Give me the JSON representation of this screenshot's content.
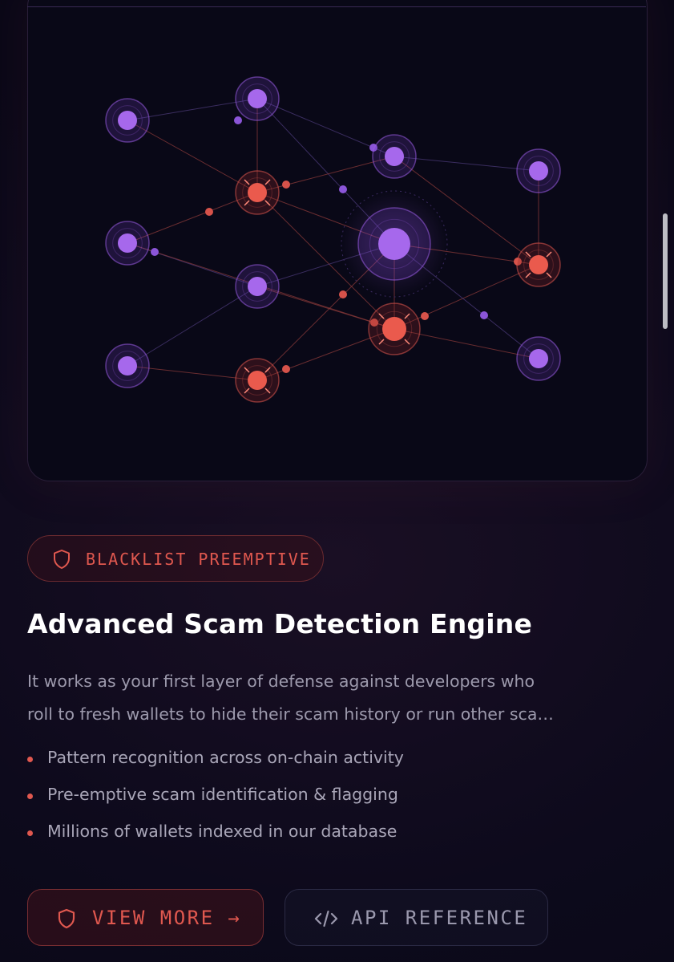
{
  "badge": {
    "label": "BLACKLIST PREEMPTIVE",
    "icon": "shield-icon"
  },
  "title": "Advanced Scam Detection Engine",
  "description": {
    "line1": "It works as your first layer of defense against developers who",
    "line2": "roll to fresh wallets to hide their scam history or run other sca…"
  },
  "features": [
    "Pattern recognition across on-chain activity",
    "Pre-emptive scam identification & flagging",
    "Millions of wallets indexed in our database"
  ],
  "buttons": {
    "view_more": {
      "label": "VIEW MORE →",
      "icon": "shield-icon"
    },
    "api_reference": {
      "label": "API REFERENCE",
      "icon": "code-icon"
    }
  },
  "colors": {
    "accent_red": "#e0584f",
    "accent_purple": "#9b5de5",
    "background": "#0a0817"
  },
  "network": {
    "nodes": [
      {
        "id": "n1",
        "status": "wallet"
      },
      {
        "id": "n2",
        "status": "wallet"
      },
      {
        "id": "n3",
        "status": "wallet"
      },
      {
        "id": "n4",
        "status": "wallet"
      },
      {
        "id": "n5",
        "status": "wallet"
      },
      {
        "id": "n6",
        "status": "wallet"
      },
      {
        "id": "n7",
        "status": "hub"
      },
      {
        "id": "n8",
        "status": "wallet"
      },
      {
        "id": "n9",
        "status": "wallet"
      },
      {
        "id": "s1",
        "status": "flagged"
      },
      {
        "id": "s2",
        "status": "flagged"
      },
      {
        "id": "s3",
        "status": "flagged"
      },
      {
        "id": "s4",
        "status": "flagged"
      }
    ],
    "links": [
      [
        "n1",
        "n2"
      ],
      [
        "n1",
        "s1"
      ],
      [
        "n2",
        "s1"
      ],
      [
        "n2",
        "n6"
      ],
      [
        "n2",
        "n7"
      ],
      [
        "s1",
        "n6"
      ],
      [
        "s1",
        "n3"
      ],
      [
        "s1",
        "n7"
      ],
      [
        "s1",
        "s3"
      ],
      [
        "n3",
        "n4"
      ],
      [
        "n3",
        "s3"
      ],
      [
        "n4",
        "n7"
      ],
      [
        "n4",
        "s3"
      ],
      [
        "n4",
        "n5"
      ],
      [
        "n5",
        "s4"
      ],
      [
        "s4",
        "n7"
      ],
      [
        "s4",
        "s3"
      ],
      [
        "n6",
        "n8"
      ],
      [
        "n6",
        "s2"
      ],
      [
        "n7",
        "s2"
      ],
      [
        "n7",
        "s3"
      ],
      [
        "s3",
        "s2"
      ],
      [
        "s3",
        "n9"
      ],
      [
        "n8",
        "s2"
      ],
      [
        "n7",
        "n9"
      ]
    ]
  }
}
